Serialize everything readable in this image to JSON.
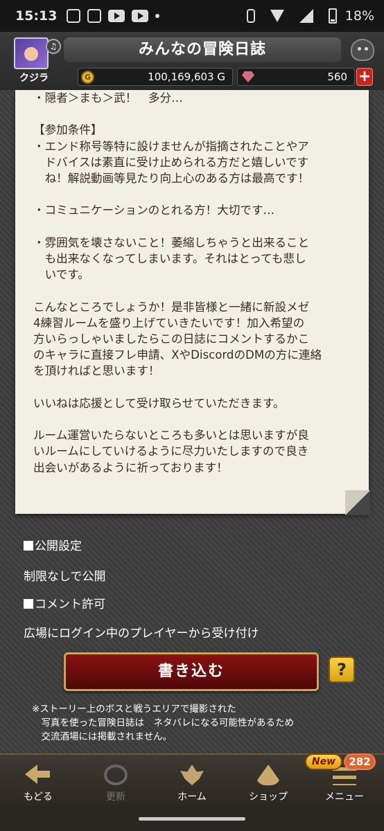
{
  "status_bar": {
    "time": "15:13",
    "battery": "18%"
  },
  "header": {
    "title": "みんなの冒険日誌",
    "avatar_name": "クジラ",
    "gold": "100,169,603 G",
    "gold_icon_letter": "G",
    "gems": "560",
    "plus_label": "+"
  },
  "diary": {
    "body": "・隠者＞まも＞武！　多分…\n\n【参加条件】\n・エンド称号等特に設けませんが指摘されたことやア\n　ドバイスは素直に受け止められる方だと嬉しいです\n　ね！解説動画等見たり向上心のある方は最高です！\n\n・コミュニケーションのとれる方！大切です…\n\n・雰囲気を壊さないこと！萎縮しちゃうと出来ること\n　も出来なくなってしまいます。それはとっても悲し\n　いです。\n\nこんなところでしょうか！是非皆様と一緒に新設メゼ\n4練習ルームを盛り上げていきたいです！加入希望の\n方いらっしゃいましたらこの日誌にコメントするかこ\nのキャラに直接フレ申請、XやDiscordのDMの方に連絡\nを頂ければと思います！\n\nいいねは応援として受け取らせていただきます。\n\nルーム運営いたらないところも多いとは思いますが良\nいルームにしていけるように尽力いたしますので良き\n出会いがあるように祈っております！"
  },
  "settings": {
    "public_label": "公開設定",
    "public_value": "制限なしで公開",
    "comment_label": "コメント許可",
    "comment_value": "広場にログイン中のプレイヤーから受け付け"
  },
  "actions": {
    "write_label": "書き込む",
    "help_label": "?"
  },
  "notice": "※ストーリー上のボスと戦うエリアで撮影された\n　写真を使った冒険日誌は　ネタバレになる可能性があるため\n　交流酒場には掲載されません。",
  "nav": {
    "back": "もどる",
    "refresh": "更新",
    "home": "ホーム",
    "shop": "ショップ",
    "menu": "メニュー",
    "new_badge": "New",
    "count_badge": "282"
  },
  "colors": {
    "write_button": "#6e0d0d",
    "help_button": "#f0c030",
    "paper": "#f1efe6"
  }
}
